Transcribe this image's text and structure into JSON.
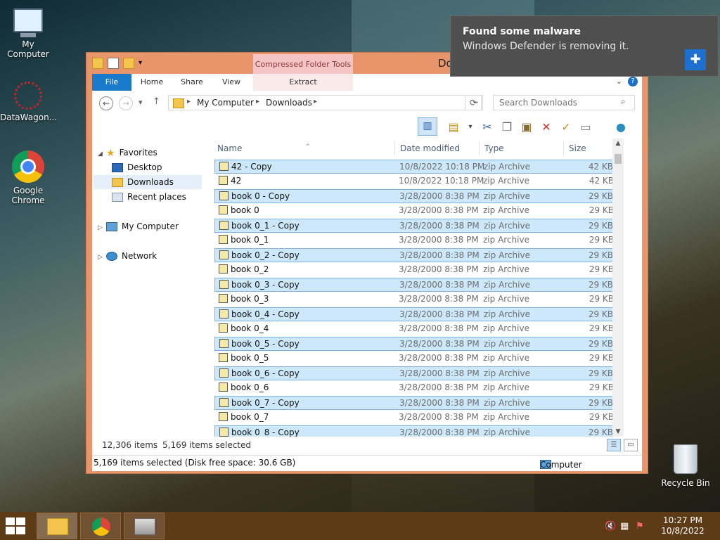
{
  "desktop": {
    "icons": [
      {
        "label": "My Computer"
      },
      {
        "label": "DataWagon..."
      },
      {
        "label": "Google Chrome"
      },
      {
        "label": "Recycle Bin"
      }
    ]
  },
  "window": {
    "title": "Do",
    "context_tab": "Compressed Folder Tools",
    "tabs": [
      "File",
      "Home",
      "Share",
      "View",
      "Extract"
    ],
    "address": {
      "crumbs": [
        "My Computer",
        "Downloads"
      ]
    },
    "search_placeholder": "Search Downloads"
  },
  "navpane": {
    "favorites": "Favorites",
    "items": [
      "Desktop",
      "Downloads",
      "Recent places"
    ],
    "computer": "My Computer",
    "network": "Network"
  },
  "columns": [
    "Name",
    "Date modified",
    "Type",
    "Size"
  ],
  "files": [
    {
      "name": "42 - Copy",
      "date": "10/8/2022 10:18 PM",
      "type": "zip Archive",
      "size": "42 KB",
      "selected": true
    },
    {
      "name": "42",
      "date": "10/8/2022 10:18 PM",
      "type": "zip Archive",
      "size": "42 KB",
      "selected": false
    },
    {
      "name": "book 0 - Copy",
      "date": "3/28/2000 8:38 PM",
      "type": "zip Archive",
      "size": "29 KB",
      "selected": true
    },
    {
      "name": "book 0",
      "date": "3/28/2000 8:38 PM",
      "type": "zip Archive",
      "size": "29 KB",
      "selected": false
    },
    {
      "name": "book 0_1 - Copy",
      "date": "3/28/2000 8:38 PM",
      "type": "zip Archive",
      "size": "29 KB",
      "selected": true
    },
    {
      "name": "book 0_1",
      "date": "3/28/2000 8:38 PM",
      "type": "zip Archive",
      "size": "29 KB",
      "selected": false
    },
    {
      "name": "book 0_2 - Copy",
      "date": "3/28/2000 8:38 PM",
      "type": "zip Archive",
      "size": "29 KB",
      "selected": true
    },
    {
      "name": "book 0_2",
      "date": "3/28/2000 8:38 PM",
      "type": "zip Archive",
      "size": "29 KB",
      "selected": false
    },
    {
      "name": "book 0_3 - Copy",
      "date": "3/28/2000 8:38 PM",
      "type": "zip Archive",
      "size": "29 KB",
      "selected": true
    },
    {
      "name": "book 0_3",
      "date": "3/28/2000 8:38 PM",
      "type": "zip Archive",
      "size": "29 KB",
      "selected": false
    },
    {
      "name": "book 0_4 - Copy",
      "date": "3/28/2000 8:38 PM",
      "type": "zip Archive",
      "size": "29 KB",
      "selected": true
    },
    {
      "name": "book 0_4",
      "date": "3/28/2000 8:38 PM",
      "type": "zip Archive",
      "size": "29 KB",
      "selected": false
    },
    {
      "name": "book 0_5 - Copy",
      "date": "3/28/2000 8:38 PM",
      "type": "zip Archive",
      "size": "29 KB",
      "selected": true
    },
    {
      "name": "book 0_5",
      "date": "3/28/2000 8:38 PM",
      "type": "zip Archive",
      "size": "29 KB",
      "selected": false
    },
    {
      "name": "book 0_6 - Copy",
      "date": "3/28/2000 8:38 PM",
      "type": "zip Archive",
      "size": "29 KB",
      "selected": true
    },
    {
      "name": "book 0_6",
      "date": "3/28/2000 8:38 PM",
      "type": "zip Archive",
      "size": "29 KB",
      "selected": false
    },
    {
      "name": "book 0_7 - Copy",
      "date": "3/28/2000 8:38 PM",
      "type": "zip Archive",
      "size": "29 KB",
      "selected": true
    },
    {
      "name": "book 0_7",
      "date": "3/28/2000 8:38 PM",
      "type": "zip Archive",
      "size": "29 KB",
      "selected": false
    },
    {
      "name": "book 0_8 - Copy",
      "date": "3/28/2000 8:38 PM",
      "type": "zip Archive",
      "size": "29 KB",
      "selected": true
    }
  ],
  "status": {
    "count": "12,306 items",
    "selected": "5,169 items selected",
    "details": "5,169 items selected (Disk free space: 30.6 GB)",
    "location": "Computer"
  },
  "toast": {
    "title": "Found some malware",
    "message": "Windows Defender is removing it."
  },
  "taskbar": {
    "time": "10:27 PM",
    "date": "10/8/2022"
  },
  "icons": {
    "file": "zip-archive-icon",
    "defender": "shield-icon"
  }
}
